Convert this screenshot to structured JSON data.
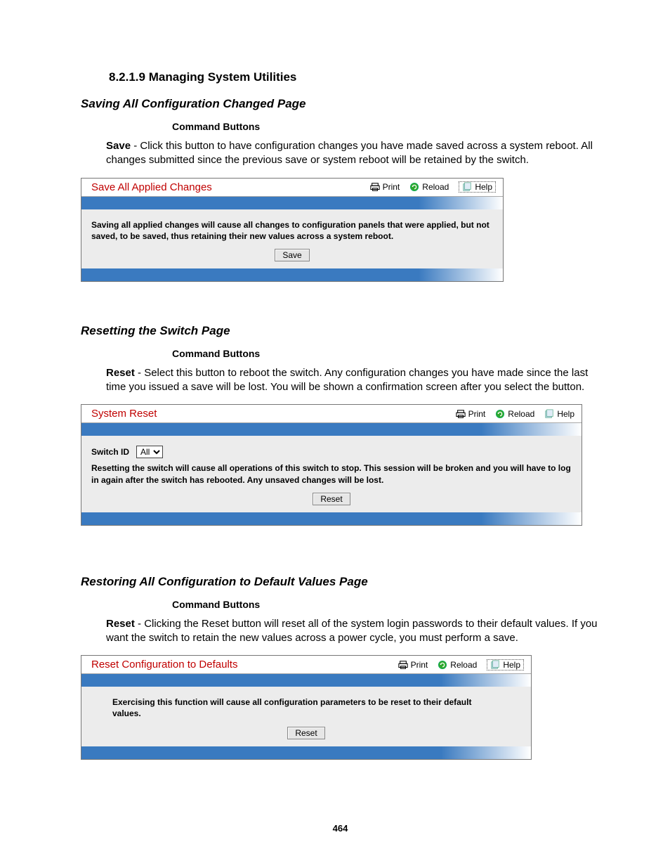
{
  "header": {
    "section_number": "8.2.1.9",
    "section_title": "Managing System Utilities"
  },
  "section1": {
    "title": "Saving All Configuration Changed Page",
    "cmd_label": "Command Buttons",
    "para_bold": "Save",
    "para_rest": " - Click this button to have configuration changes you have made saved across a system reboot. All changes submitted since the previous save or system reboot will be retained by the switch.",
    "panel": {
      "title": "Save All Applied Changes",
      "print": "Print",
      "reload": "Reload",
      "help": "Help",
      "body": "Saving all applied changes will cause all changes to configuration panels that were applied, but not saved, to be saved, thus retaining their new values across a system reboot.",
      "button": "Save"
    }
  },
  "section2": {
    "title": "Resetting the Switch Page",
    "cmd_label": "Command Buttons",
    "para_bold": "Reset",
    "para_rest": " - Select this button to reboot the switch. Any configuration changes you have made since the last time you issued a save will be lost. You will be shown a confirmation screen after you select the button.",
    "panel": {
      "title": "System Reset",
      "print": "Print",
      "reload": "Reload",
      "help": "Help",
      "switch_label": "Switch ID",
      "switch_value": "All",
      "body": "Resetting the switch will cause all operations of this switch to stop. This session will be broken and you will have to log in again after the switch has rebooted. Any unsaved changes will be lost.",
      "button": "Reset"
    }
  },
  "section3": {
    "title": "Restoring All Configuration to Default Values Page",
    "cmd_label": "Command Buttons",
    "para_bold": "Reset",
    "para_rest": " - Clicking the Reset button will reset all of the system login passwords to their default values. If you want the switch to retain the new values across a power cycle, you must perform a save.",
    "panel": {
      "title": "Reset Configuration to Defaults",
      "print": "Print",
      "reload": "Reload",
      "help": "Help",
      "body": "Exercising this function will cause all configuration parameters to be reset to their default values.",
      "button": "Reset"
    }
  },
  "page_number": "464"
}
